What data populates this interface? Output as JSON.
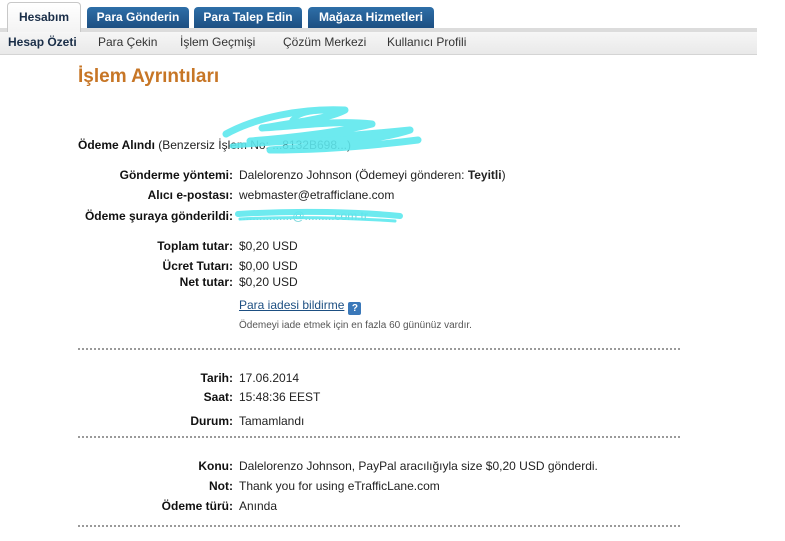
{
  "tabs": [
    {
      "label": "Hesabım",
      "active": true
    },
    {
      "label": "Para Gönderin",
      "active": false
    },
    {
      "label": "Para Talep Edin",
      "active": false
    },
    {
      "label": "Mağaza Hizmetleri",
      "active": false
    }
  ],
  "subnav": [
    {
      "label": "Hesap Özeti",
      "active": true
    },
    {
      "label": "Para Çekin",
      "active": false
    },
    {
      "label": "İşlem Geçmişi",
      "active": false
    },
    {
      "label": "Çözüm Merkezi",
      "active": false
    },
    {
      "label": "Kullanıcı Profili",
      "active": false
    }
  ],
  "page_title": "İşlem Ayrıntıları",
  "payment": {
    "heading_label": "Ödeme Alındı",
    "heading_detail": " (Benzersiz İşlem No: ...8132B698...)",
    "method_label": "Gönderme yöntemi:",
    "method_value_prefix": "Dalelorenzo Johnson (Ödemeyi gönderen: ",
    "method_value_status": "Teyitli",
    "method_value_suffix": ")",
    "receiver_email_label": "Alıcı e-postası:",
    "receiver_email_value": "webmaster@etrafficlane.com",
    "sent_to_label": "Ödeme şuraya gönderildi:",
    "sent_to_value": "................@.........com.tr",
    "total_label": "Toplam tutar:",
    "total_value": "$0,20 USD",
    "fee_label": "Ücret Tutarı:",
    "fee_value": "$0,00 USD",
    "net_label": "Net tutar:",
    "net_value": "$0,20 USD",
    "refund_link": "Para iadesi bildirme",
    "help_glyph": "?",
    "refund_note": "Ödemeyi iade etmek için en fazla 60 gününüz vardır."
  },
  "timing": {
    "date_label": "Tarih:",
    "date_value": "17.06.2014",
    "time_label": "Saat:",
    "time_value": "15:48:36 EEST",
    "status_label": "Durum:",
    "status_value": "Tamamlandı"
  },
  "info": {
    "subject_label": "Konu:",
    "subject_value": "Dalelorenzo Johnson, PayPal aracılığıyla size $0,20 USD gönderdi.",
    "note_label": "Not:",
    "note_value": "Thank you for using eTrafficLane.com",
    "payment_type_label": "Ödeme türü:",
    "payment_type_value": "Anında"
  },
  "colors": {
    "tab_blue": "#1d4f82",
    "title_orange": "#c77626",
    "redaction_cyan": "#5ee8ee"
  }
}
